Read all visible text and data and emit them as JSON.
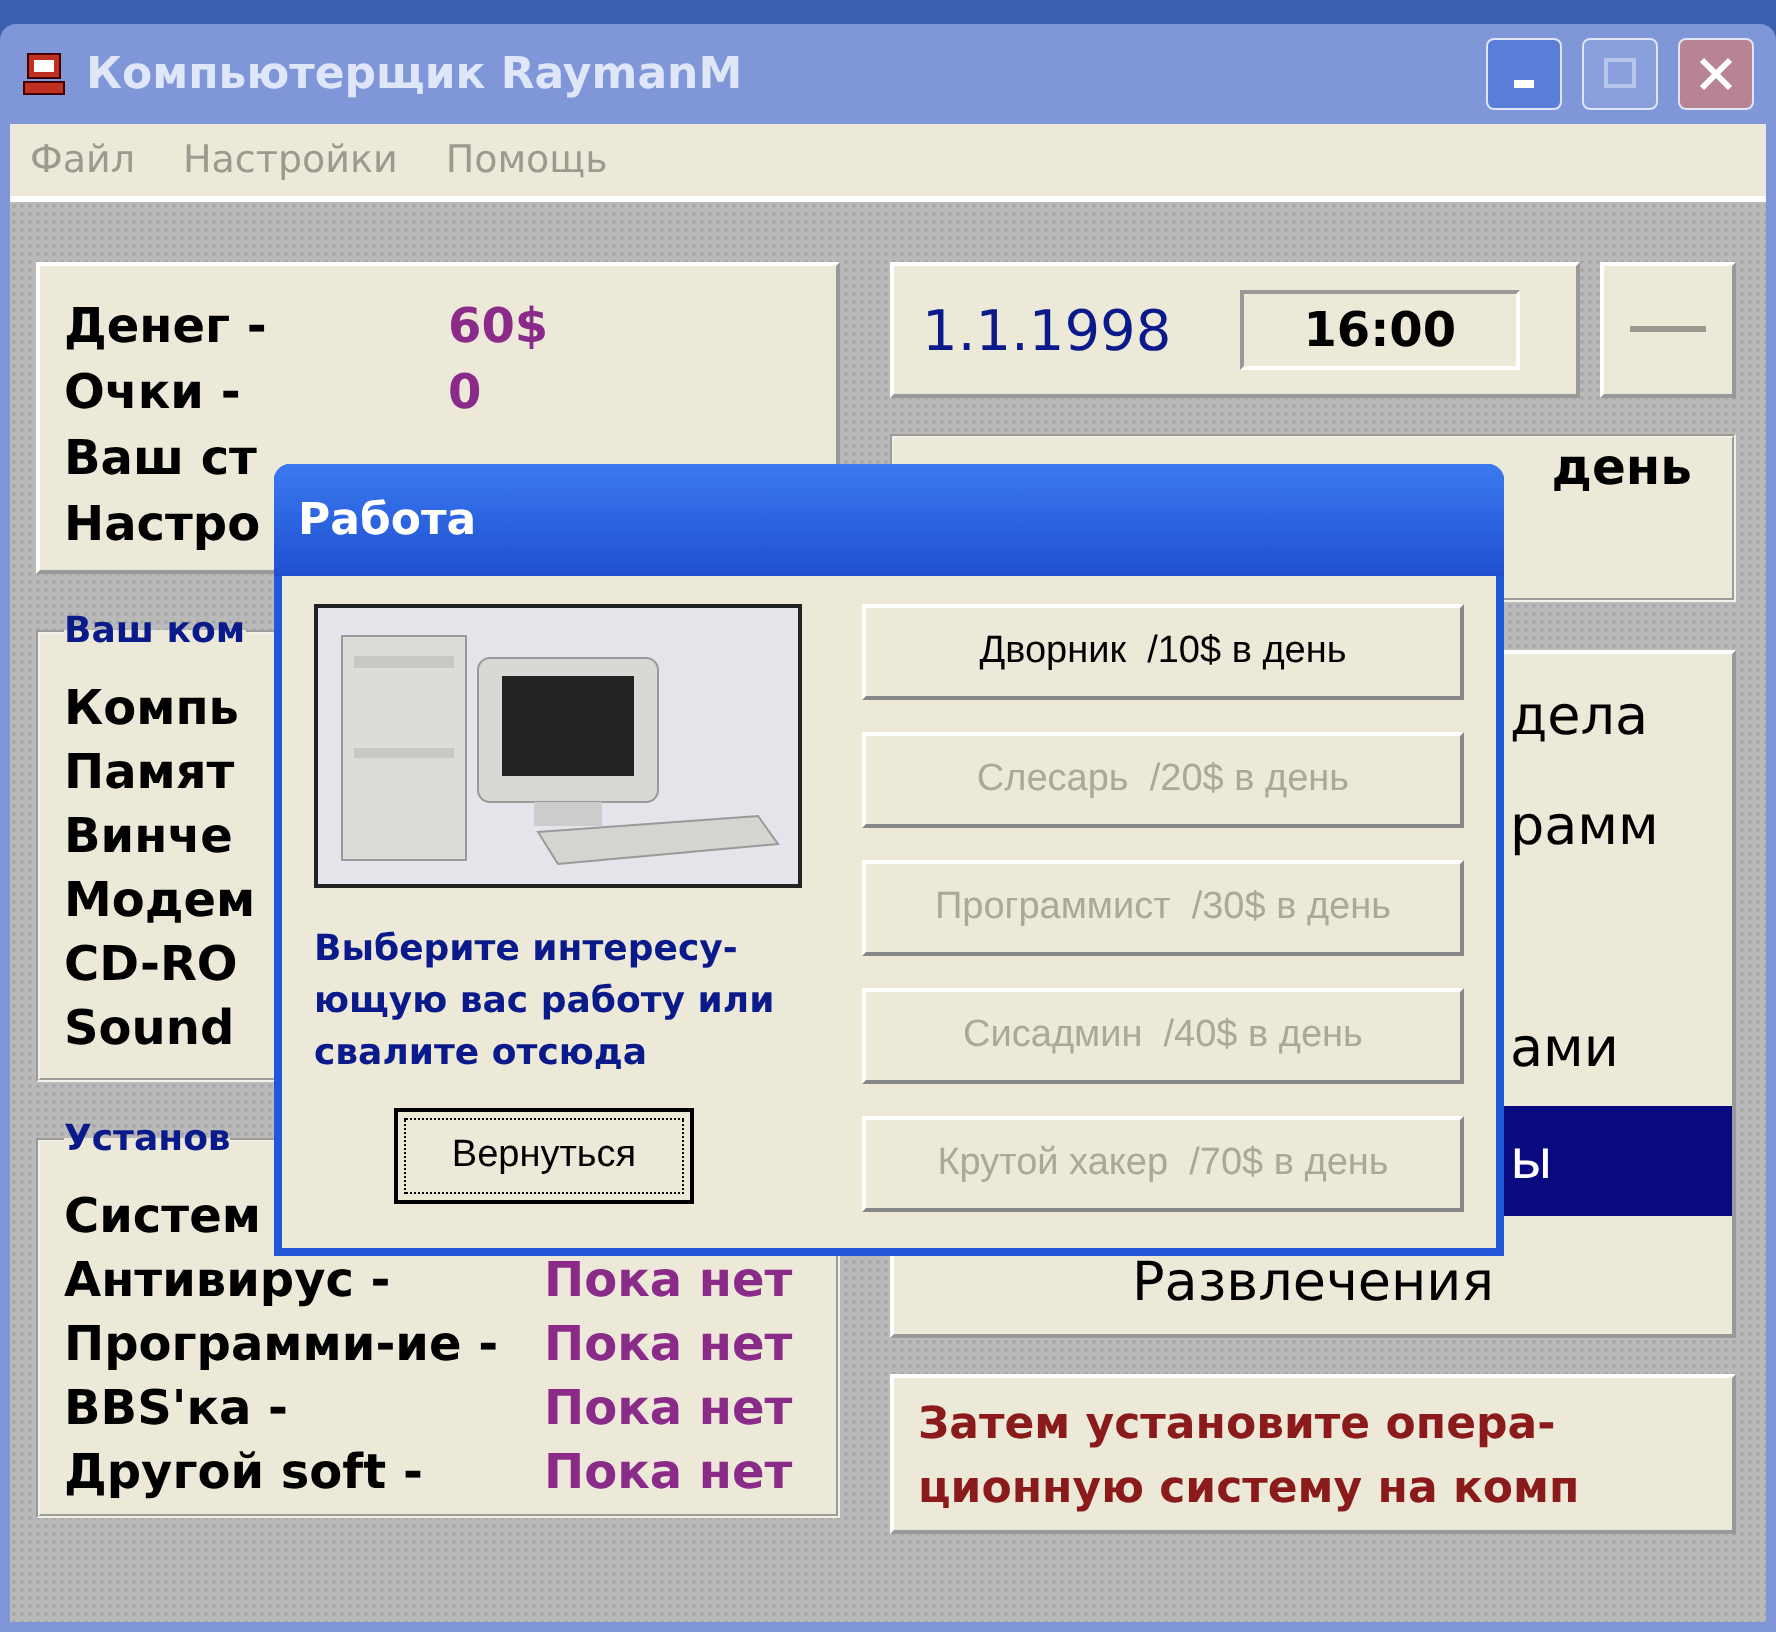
{
  "window": {
    "title": "Компьютерщик RaymanM"
  },
  "menu": [
    {
      "label": "Файл"
    },
    {
      "label": "Настройки"
    },
    {
      "label": "Помощь"
    }
  ],
  "stats": [
    {
      "label": "Денег -",
      "value": "60$"
    },
    {
      "label": "Очки -",
      "value": "0"
    },
    {
      "label": "Ваш ст"
    },
    {
      "label": "Настро"
    }
  ],
  "computer": {
    "legend": "Ваш ком",
    "items": [
      "Компь",
      "Памят",
      "Винче",
      "Модем",
      "CD-RO",
      "Sound"
    ]
  },
  "software": {
    "legend": "Установ",
    "items": [
      {
        "label": "Систем"
      },
      {
        "label": "Антивирус -",
        "value": "Пока нет"
      },
      {
        "label": "Программи-ие -",
        "value": "Пока нет"
      },
      {
        "label": "BBS'ка -",
        "value": "Пока нет"
      },
      {
        "label": "Другой soft -",
        "value": "Пока нет"
      }
    ]
  },
  "date": "1.1.1998",
  "time": "16:00",
  "job": {
    "text": "день"
  },
  "actions": [
    {
      "label": "дела",
      "kind": "partial",
      "selected": false
    },
    {
      "label": "рамм",
      "kind": "partial",
      "selected": false
    },
    {
      "label": "ами",
      "kind": "partial",
      "selected": false
    },
    {
      "label": "ы",
      "kind": "partial",
      "selected": true
    },
    {
      "label": "Развлечения",
      "kind": "full",
      "selected": false
    }
  ],
  "hint": "Затем установите опера-\nционную систему на комп",
  "dialog": {
    "title": "Работа",
    "message": "Выберите интересу-\nющую вас работу или\nсвалите отсюда",
    "back_button": "Вернуться",
    "jobs": [
      {
        "label": "Дворник  /10$ в день",
        "disabled": false
      },
      {
        "label": "Слесарь  /20$ в день",
        "disabled": true
      },
      {
        "label": "Программист  /30$ в день",
        "disabled": true
      },
      {
        "label": "Сисадмин  /40$ в день",
        "disabled": true
      },
      {
        "label": "Крутой хакер  /70$ в день",
        "disabled": true
      }
    ]
  }
}
